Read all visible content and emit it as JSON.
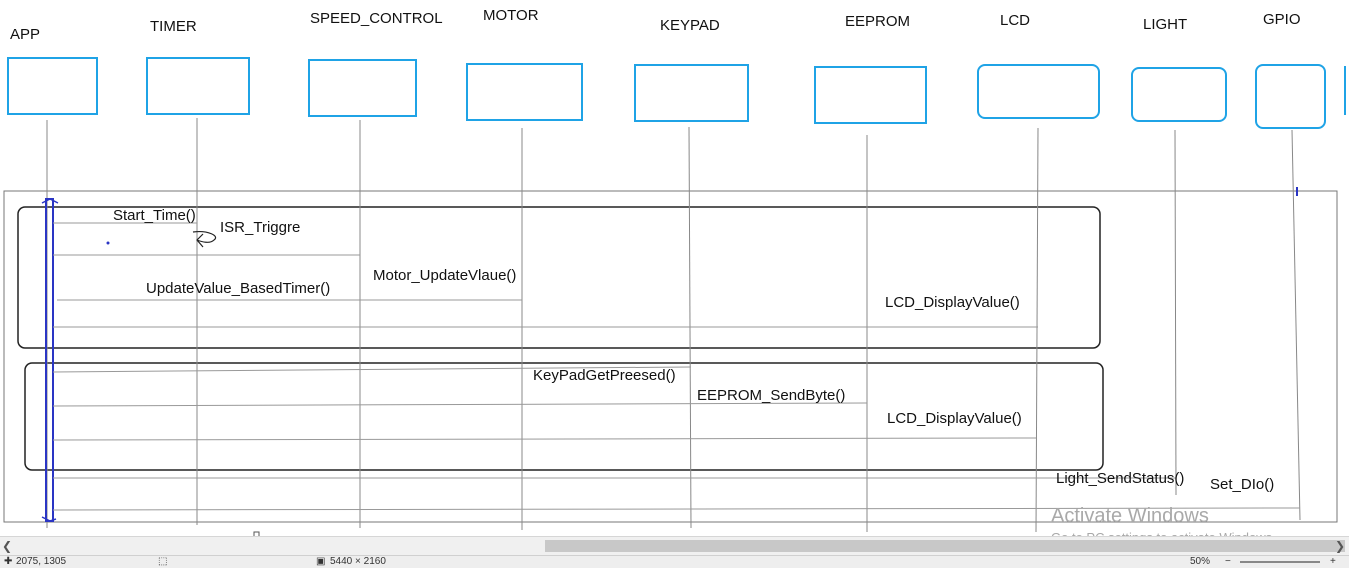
{
  "lifelines": [
    {
      "name": "APP"
    },
    {
      "name": "TIMER"
    },
    {
      "name": "SPEED_CONTROL"
    },
    {
      "name": "MOTOR"
    },
    {
      "name": "KEYPAD"
    },
    {
      "name": "EEPROM"
    },
    {
      "name": "LCD"
    },
    {
      "name": "LIGHT"
    },
    {
      "name": "GPIO"
    }
  ],
  "messages": [
    {
      "label": "Start_Time()"
    },
    {
      "label": "ISR_Triggre"
    },
    {
      "label": "UpdateValue_BasedTimer()"
    },
    {
      "label": "Motor_UpdateVlaue()"
    },
    {
      "label": "LCD_DisplayValue()"
    },
    {
      "label": "KeyPadGetPreesed()"
    },
    {
      "label": "EEPROM_SendByte()"
    },
    {
      "label": "LCD_DisplayValue()"
    },
    {
      "label": "Light_SendStatus()"
    },
    {
      "label": "Set_DIo()"
    }
  ],
  "colors": {
    "lifeline_box": "#1fa3e6",
    "activation": "#2a35c4",
    "frame": "#222222",
    "line": "#888888"
  },
  "watermark": {
    "title": "Activate Windows",
    "subtitle": "Go to PC settings to activate Windows."
  },
  "statusbar": {
    "coords": "2075, 1305",
    "size": "5440 × 2160",
    "zoom": "50%"
  }
}
